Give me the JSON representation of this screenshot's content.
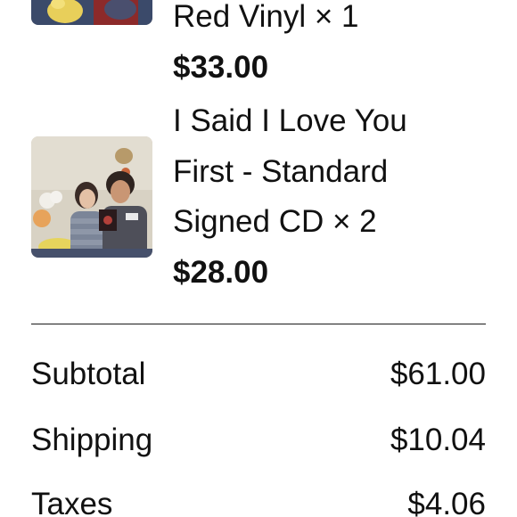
{
  "items": [
    {
      "title_lines": [
        "Red Vinyl × 1"
      ],
      "price": "$33.00",
      "thumbnail_icon": "album-photo-icon"
    },
    {
      "title_lines": [
        "I Said I Love You",
        "First - Standard",
        "Signed CD × 2"
      ],
      "price": "$28.00",
      "thumbnail_icon": "album-photo-icon"
    }
  ],
  "summary": {
    "subtotal_label": "Subtotal",
    "subtotal_value": "$61.00",
    "shipping_label": "Shipping",
    "shipping_value": "$10.04",
    "taxes_label": "Taxes",
    "taxes_value": "$4.06"
  }
}
